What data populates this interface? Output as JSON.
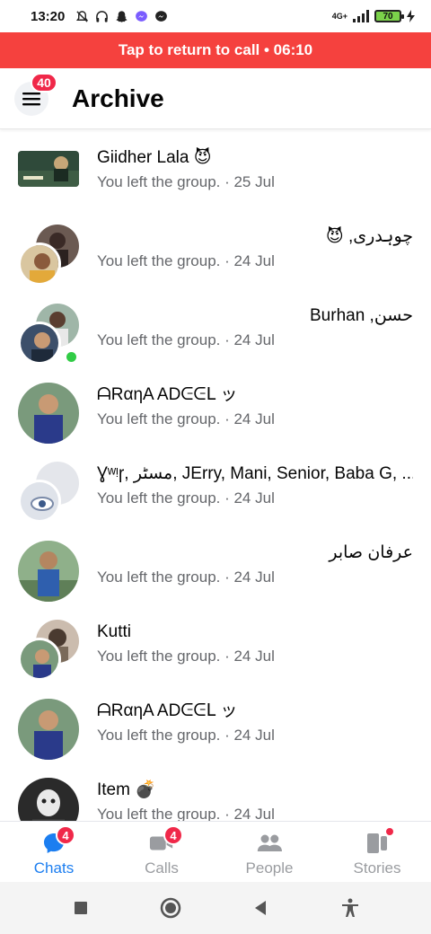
{
  "status_bar": {
    "time": "13:20",
    "network": "4G+",
    "battery": "70",
    "icons": [
      "bell-off-icon",
      "headphones-icon",
      "snapchat-icon",
      "messenger-icon",
      "messenger-icon"
    ]
  },
  "call_banner": {
    "text": "Tap to return to call • 06:10"
  },
  "header": {
    "menu_badge": "40",
    "title": "Archive"
  },
  "chats": [
    {
      "name": "Giidher Lala 😈",
      "subtitle": "You left the group. · 25 Jul",
      "rtl": false
    },
    {
      "name": "چوہدری, 😈",
      "subtitle": "You left the group. · 24 Jul",
      "rtl": true
    },
    {
      "name": "حسن, Burhan",
      "subtitle": "You left the group. · 24 Jul",
      "rtl": true
    },
    {
      "name": "ᗩRαηA ADᕮᕮᒪ ッ",
      "subtitle": "You left the group. · 24 Jul",
      "rtl": false
    },
    {
      "name": "Ɣʷᵎɼ, مسٹر, JErry, Mani, Senior, Baba G, ...خ",
      "subtitle": "You left the group. · 24 Jul",
      "rtl": false
    },
    {
      "name": "عرفان صابر",
      "subtitle": "You left the group. · 24 Jul",
      "rtl": true
    },
    {
      "name": "Kutti",
      "subtitle": "You left the group. · 24 Jul",
      "rtl": false
    },
    {
      "name": "ᗩRαηA ADᕮᕮᒪ ッ",
      "subtitle": "You left the group. · 24 Jul",
      "rtl": false
    },
    {
      "name": "Item 💣",
      "subtitle": "You left the group. · 24 Jul",
      "rtl": false
    }
  ],
  "bottom_nav": {
    "tabs": [
      {
        "label": "Chats",
        "badge": "4",
        "icon": "chat-bubble-icon",
        "active": true
      },
      {
        "label": "Calls",
        "badge": "4",
        "icon": "video-camera-icon",
        "active": false
      },
      {
        "label": "People",
        "badge": "",
        "icon": "people-icon",
        "active": false
      },
      {
        "label": "Stories",
        "badge": "",
        "icon": "stories-icon",
        "active": false
      }
    ]
  },
  "colors": {
    "banner": "#f5413e",
    "accent": "#1c7ef0",
    "badge": "#f02849",
    "online": "#31cc46"
  }
}
